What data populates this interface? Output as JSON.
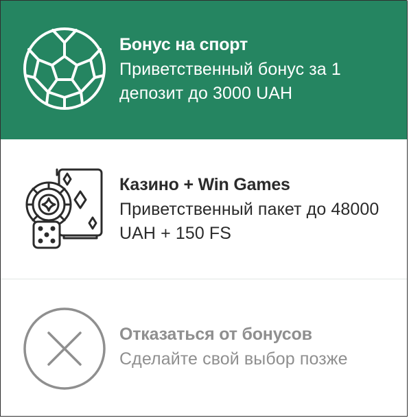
{
  "theme": {
    "accent": "#258561",
    "text_dark": "#2b2b2b",
    "text_muted": "#8f8f8f",
    "on_accent": "#ffffff"
  },
  "options": [
    {
      "title": "Бонус на спорт",
      "description": "Приветственный бонус за 1 депозит до 3000 UAH",
      "icon": "soccer-ball-icon",
      "selected": true
    },
    {
      "title": "Казино + Win Games",
      "description": "Приветственный пакет до 48000 UAH + 150 FS",
      "icon": "casino-chips-cards-dice-icon",
      "selected": false
    },
    {
      "title": "Отказаться от бонусов",
      "description": "Сделайте свой выбор позже",
      "icon": "close-circle-icon",
      "selected": false
    }
  ]
}
